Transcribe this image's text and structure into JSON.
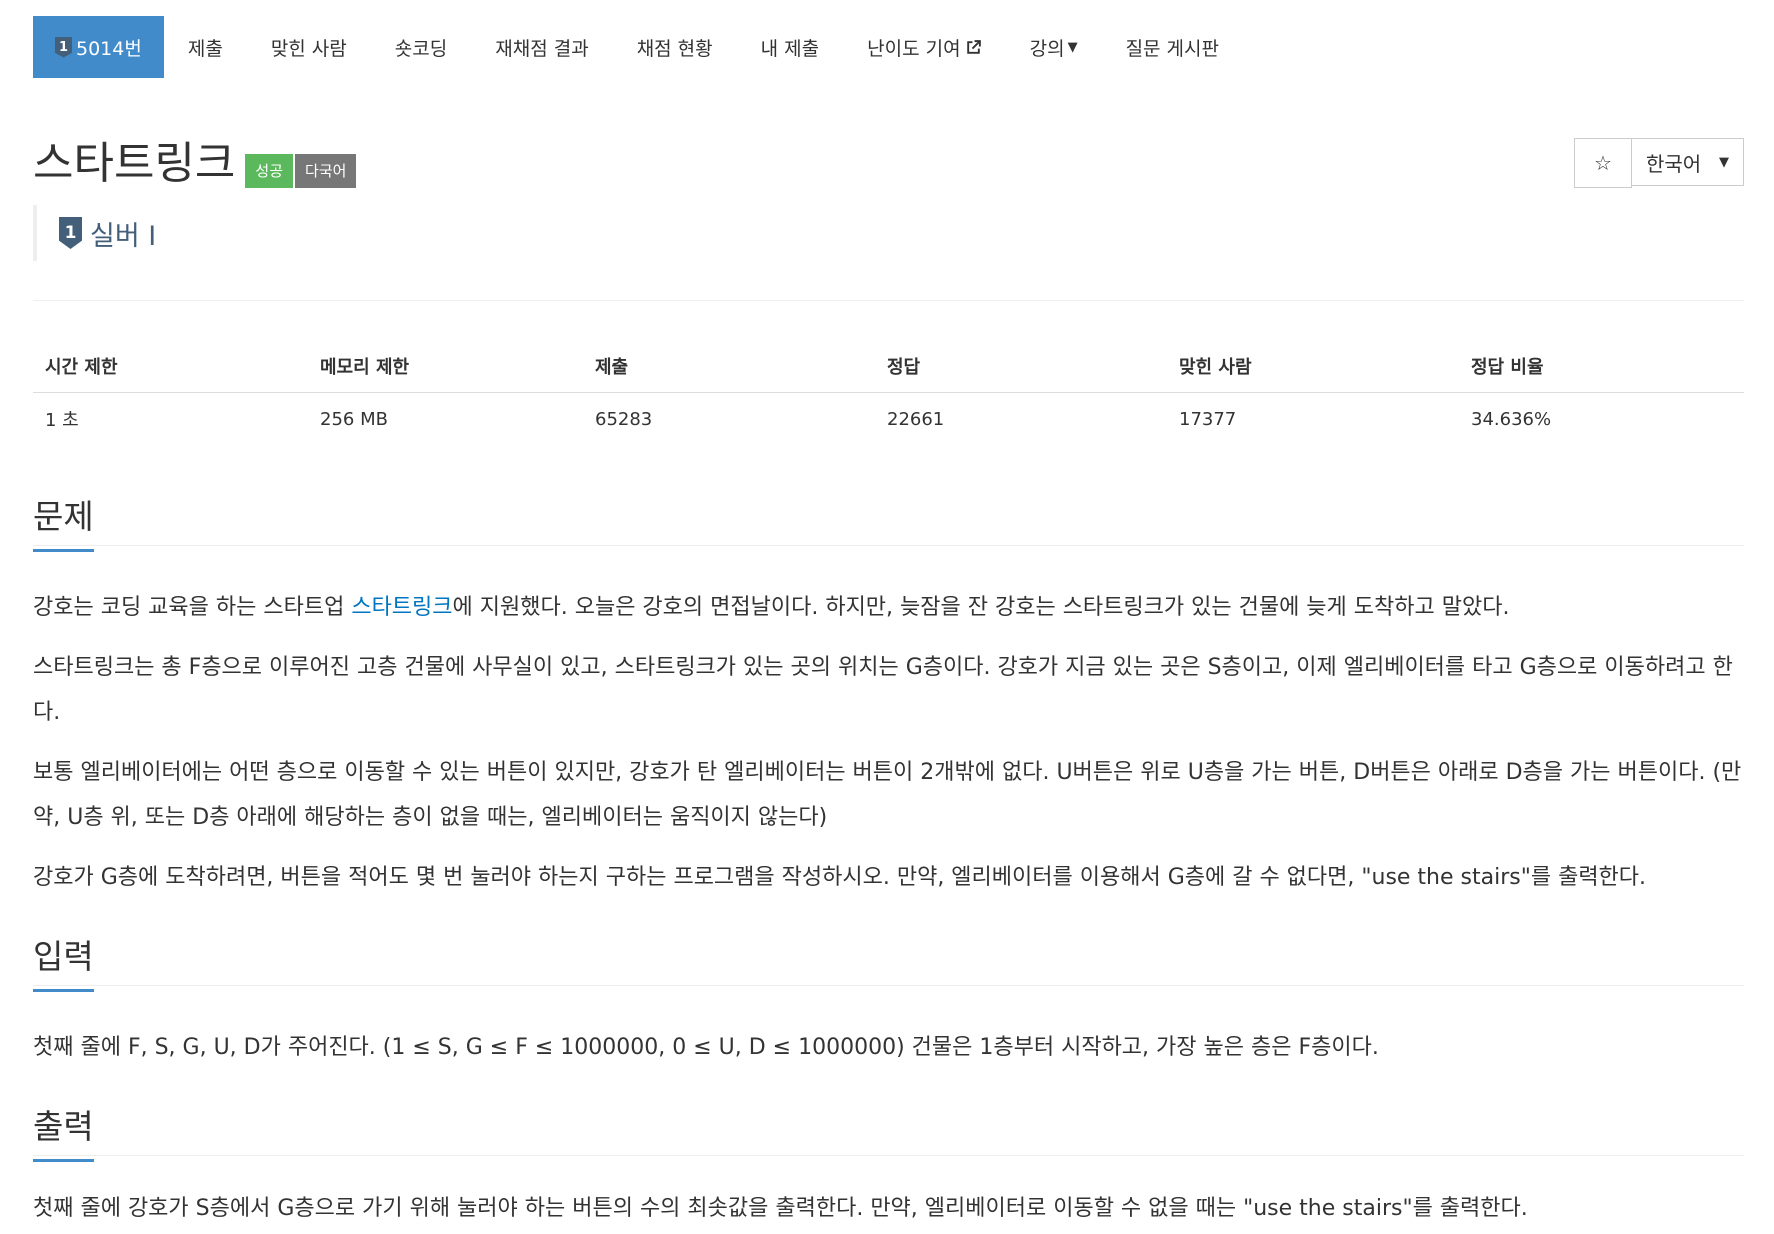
{
  "nav": {
    "active_badge": "1",
    "active_label": "5014번",
    "items": [
      {
        "label": "제출"
      },
      {
        "label": "맞힌 사람"
      },
      {
        "label": "숏코딩"
      },
      {
        "label": "재채점 결과"
      },
      {
        "label": "채점 현황"
      },
      {
        "label": "내 제출"
      },
      {
        "label": "난이도 기여",
        "icon": "external-link-icon"
      },
      {
        "label": "강의",
        "icon": "caret-down-icon"
      },
      {
        "label": "질문 게시판"
      }
    ]
  },
  "problem": {
    "title": "스타트링크",
    "labels": {
      "success": "성공",
      "multilang": "다국어"
    },
    "tier_badge": "1",
    "tier": "실버 I"
  },
  "controls": {
    "star_icon": "☆",
    "language": "한국어"
  },
  "stats": {
    "headers": [
      "시간 제한",
      "메모리 제한",
      "제출",
      "정답",
      "맞힌 사람",
      "정답 비율"
    ],
    "values": [
      "1 초",
      "256 MB",
      "65283",
      "22661",
      "17377",
      "34.636%"
    ]
  },
  "sections": {
    "problem": {
      "heading": "문제",
      "p1_before": "강호는 코딩 교육을 하는 스타트업 ",
      "p1_link": "스타트링크",
      "p1_after": "에 지원했다. 오늘은 강호의 면접날이다. 하지만, 늦잠을 잔 강호는 스타트링크가 있는 건물에 늦게 도착하고 말았다.",
      "p2": "스타트링크는 총 F층으로 이루어진 고층 건물에 사무실이 있고, 스타트링크가 있는 곳의 위치는 G층이다. 강호가 지금 있는 곳은 S층이고, 이제 엘리베이터를 타고 G층으로 이동하려고 한다.",
      "p3": "보통 엘리베이터에는 어떤 층으로 이동할 수 있는 버튼이 있지만, 강호가 탄 엘리베이터는 버튼이 2개밖에 없다. U버튼은 위로 U층을 가는 버튼, D버튼은 아래로 D층을 가는 버튼이다. (만약, U층 위, 또는 D층 아래에 해당하는 층이 없을 때는, 엘리베이터는 움직이지 않는다)",
      "p4": "강호가 G층에 도착하려면, 버튼을 적어도 몇 번 눌러야 하는지 구하는 프로그램을 작성하시오. 만약, 엘리베이터를 이용해서 G층에 갈 수 없다면, \"use the stairs\"를 출력한다."
    },
    "input": {
      "heading": "입력",
      "p1": "첫째 줄에 F, S, G, U, D가 주어진다. (1 ≤ S, G ≤ F ≤ 1000000, 0 ≤ U, D ≤ 1000000) 건물은 1층부터 시작하고, 가장 높은 층은 F층이다."
    },
    "output": {
      "heading": "출력",
      "p1": "첫째 줄에 강호가 S층에서 G층으로 가기 위해 눌러야 하는 버튼의 수의 최솟값을 출력한다. 만약, 엘리베이터로 이동할 수 없을 때는 \"use the stairs\"를 출력한다."
    }
  }
}
